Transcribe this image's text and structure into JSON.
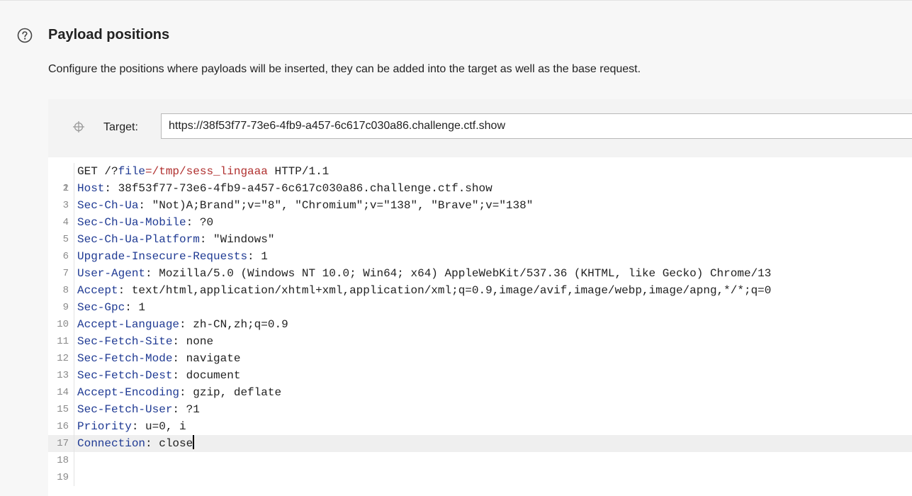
{
  "section": {
    "title": "Payload positions",
    "description": "Configure the positions where payloads will be inserted, they can be added into the target as well as the base request."
  },
  "target": {
    "label": "Target:",
    "value": "https://38f53f77-73e6-4fb9-a457-6c617c030a86.challenge.ctf.show"
  },
  "request": {
    "line1": {
      "number": "1",
      "method": "GET /?",
      "param_name": "file",
      "equals": "=",
      "param_value": "/tmp/sess_lingaaa",
      "protocol": " HTTP/1.1"
    },
    "headers": [
      {
        "number": "2",
        "name": "Host",
        "value": " 38f53f77-73e6-4fb9-a457-6c617c030a86.challenge.ctf.show"
      },
      {
        "number": "3",
        "name": "Sec-Ch-Ua",
        "value": " \"Not)A;Brand\";v=\"8\", \"Chromium\";v=\"138\", \"Brave\";v=\"138\""
      },
      {
        "number": "4",
        "name": "Sec-Ch-Ua-Mobile",
        "value": " ?0"
      },
      {
        "number": "5",
        "name": "Sec-Ch-Ua-Platform",
        "value": " \"Windows\""
      },
      {
        "number": "6",
        "name": "Upgrade-Insecure-Requests",
        "value": " 1"
      },
      {
        "number": "7",
        "name": "User-Agent",
        "value": " Mozilla/5.0 (Windows NT 10.0; Win64; x64) AppleWebKit/537.36 (KHTML, like Gecko) Chrome/13"
      },
      {
        "number": "8",
        "name": "Accept",
        "value": " text/html,application/xhtml+xml,application/xml;q=0.9,image/avif,image/webp,image/apng,*/*;q=0"
      },
      {
        "number": "9",
        "name": "Sec-Gpc",
        "value": " 1"
      },
      {
        "number": "10",
        "name": "Accept-Language",
        "value": " zh-CN,zh;q=0.9"
      },
      {
        "number": "11",
        "name": "Sec-Fetch-Site",
        "value": " none"
      },
      {
        "number": "12",
        "name": "Sec-Fetch-Mode",
        "value": " navigate"
      },
      {
        "number": "13",
        "name": "Sec-Fetch-Dest",
        "value": " document"
      },
      {
        "number": "14",
        "name": "Accept-Encoding",
        "value": " gzip, deflate"
      },
      {
        "number": "15",
        "name": "Sec-Fetch-User",
        "value": " ?1"
      },
      {
        "number": "16",
        "name": "Priority",
        "value": " u=0, i"
      },
      {
        "number": "17",
        "name": "Connection",
        "value": " close"
      }
    ],
    "empty_lines": [
      "18",
      "19"
    ],
    "active_line": "17"
  },
  "icons": {
    "help": "help-circle-icon",
    "target": "crosshair-icon"
  },
  "colors": {
    "header_name": "#1f3a93",
    "param_value": "#b0302f",
    "active_line_bg": "#efefef"
  }
}
